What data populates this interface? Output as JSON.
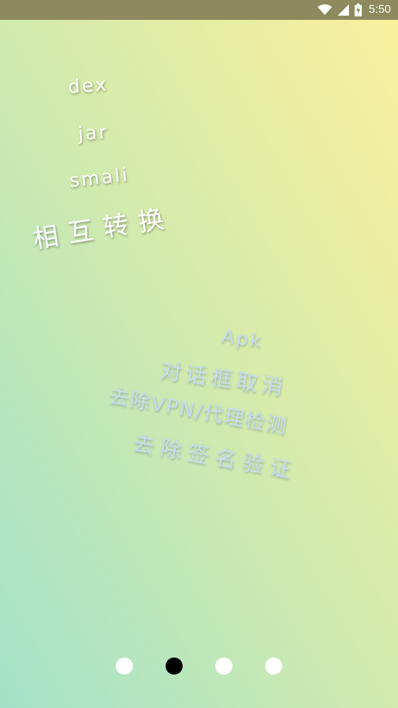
{
  "status_bar": {
    "time": "5:50",
    "icons": [
      "wifi-icon",
      "cell-signal-icon",
      "battery-charging-icon"
    ]
  },
  "slide": {
    "formats": [
      "dex",
      "jar",
      "smali"
    ],
    "convert_label": "相互转换",
    "features": [
      "Apk",
      "对话框取消",
      "去除VPN/代理检测",
      "去除签名验证"
    ]
  },
  "pager": {
    "count": 4,
    "active_index": 1
  },
  "colors": {
    "status_bar_bg": "#8e8a5e",
    "gradient_top": "#fbf09c",
    "gradient_bottom": "#a3e2c9",
    "feature_text": "#c6ddec",
    "dot_active": "#000000",
    "dot_inactive": "#ffffff"
  }
}
